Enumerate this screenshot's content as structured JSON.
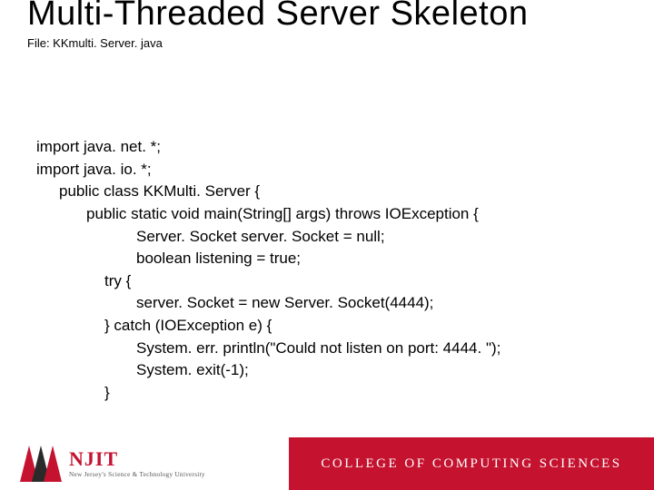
{
  "title": "Multi-Threaded Server Skeleton",
  "subtitle": "File: KKmulti. Server. java",
  "code": {
    "lines": [
      {
        "indent": 0,
        "text": "import java. net. *;"
      },
      {
        "indent": 0,
        "text": "import java. io. *;"
      },
      {
        "indent": 1,
        "text": "public class KKMulti. Server {"
      },
      {
        "indent": 2,
        "text": "public static void main(String[] args) throws IOException {"
      },
      {
        "indent": 4,
        "text": "Server. Socket server. Socket = null;"
      },
      {
        "indent": 4,
        "text": "boolean listening = true;"
      },
      {
        "indent": 3,
        "text": "try {"
      },
      {
        "indent": 4,
        "text": "server. Socket = new Server. Socket(4444);"
      },
      {
        "indent": 3,
        "text": "} catch (IOException e) {"
      },
      {
        "indent": 4,
        "text": "System. err. println(\"Could not listen on port: 4444. \");"
      },
      {
        "indent": 4,
        "text": "System. exit(-1);"
      },
      {
        "indent": 3,
        "text": "}"
      }
    ]
  },
  "footer": {
    "njit_main": "NJIT",
    "njit_sub": "New Jersey's Science & Technology University",
    "college": "COLLEGE OF COMPUTING SCIENCES"
  },
  "colors": {
    "brand_red": "#c4122f"
  }
}
